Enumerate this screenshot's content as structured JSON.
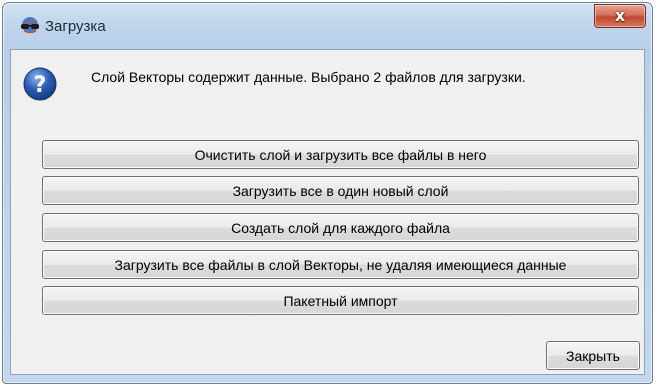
{
  "window": {
    "title": "Загрузка",
    "close_label": "x"
  },
  "message": "Слой Векторы содержит данные. Выбрано 2 файлов для загрузки.",
  "actions": [
    "Очистить слой и загрузить все файлы в него",
    "Загрузить все в один новый слой",
    "Создать слой для каждого файла",
    "Загрузить все файлы в слой Векторы, не удаляя имеющиеся данные",
    "Пакетный импорт"
  ],
  "footer": {
    "close_button": "Закрыть"
  },
  "icons": {
    "app": "globe-glasses-icon",
    "dialog": "question-icon",
    "close": "close-icon"
  },
  "colors": {
    "title_close_red": "#c0462f",
    "question_blue": "#2a5db5"
  }
}
